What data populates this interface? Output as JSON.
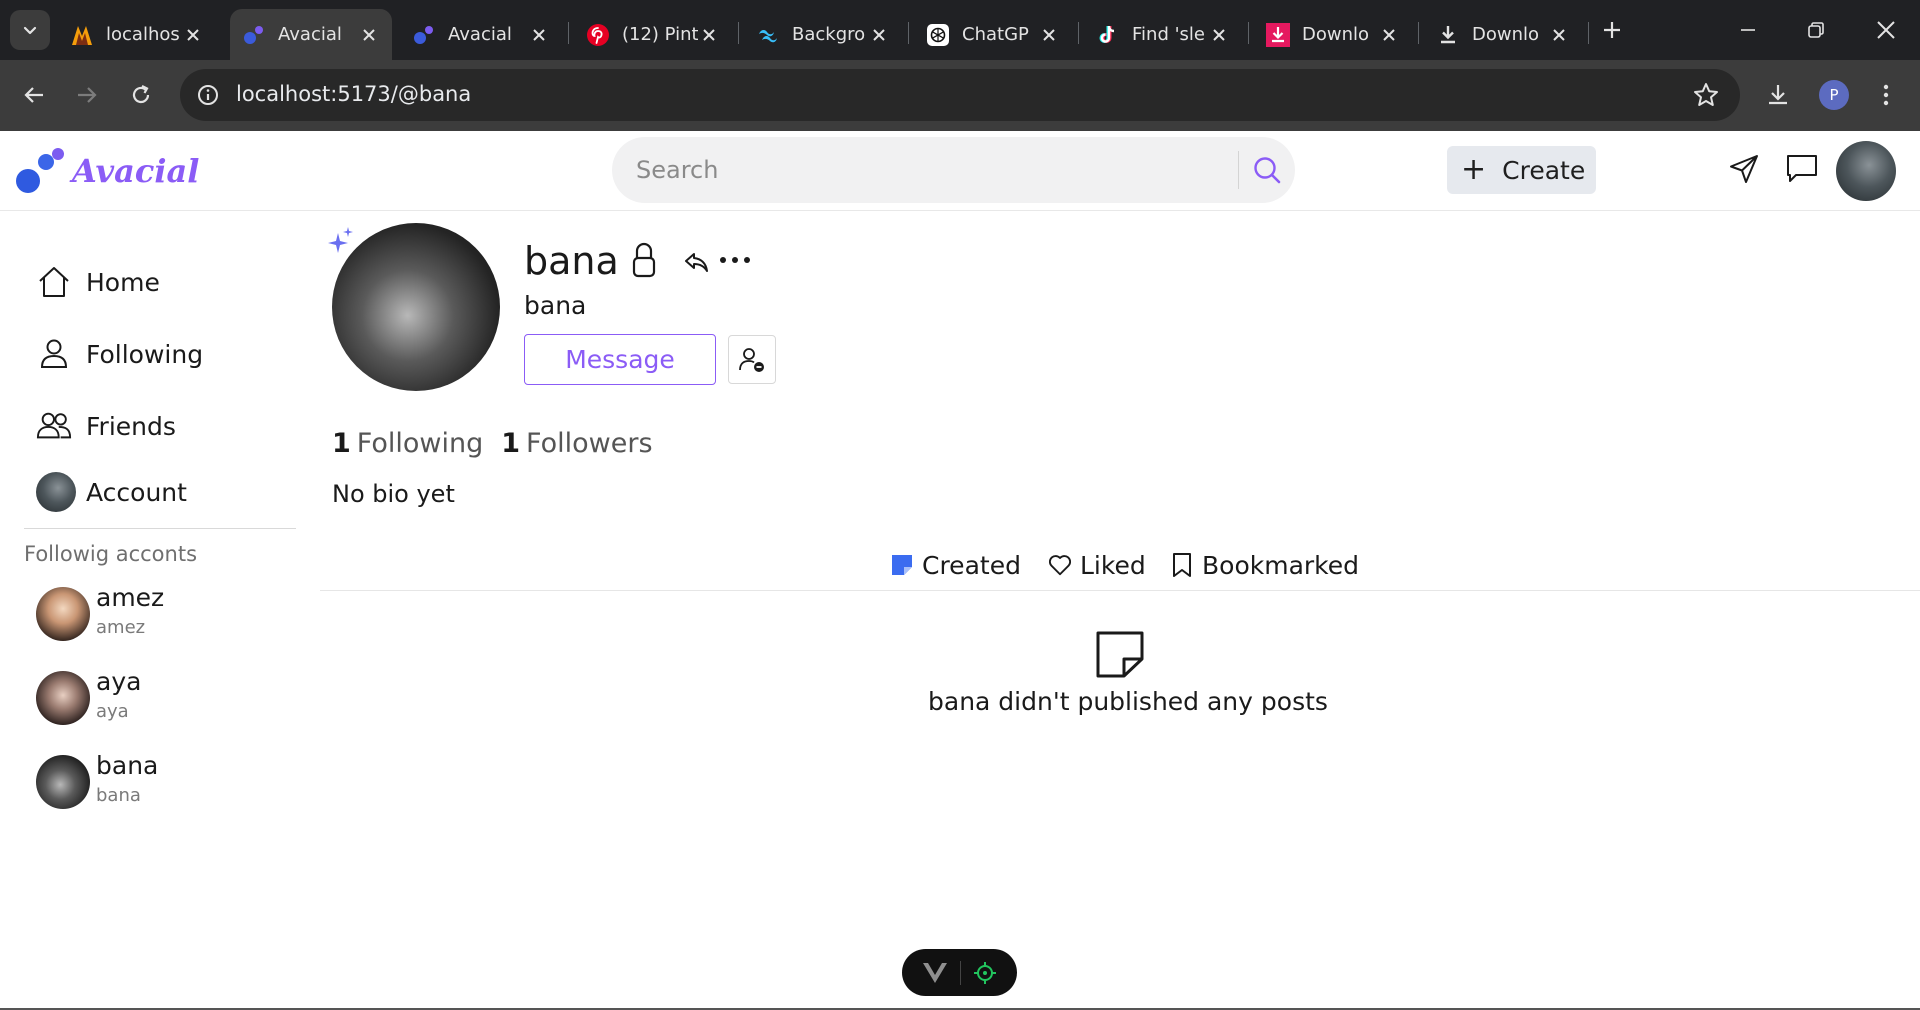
{
  "browser": {
    "tabs": [
      {
        "title": "localhos",
        "icon": "ladder-logo-icon",
        "active": false
      },
      {
        "title": "Avacial",
        "icon": "avacial-logo-icon",
        "active": true
      },
      {
        "title": "Avacial",
        "icon": "avacial-logo-icon",
        "active": false
      },
      {
        "title": "(12) Pint",
        "icon": "pinterest-icon",
        "active": false
      },
      {
        "title": "Backgro",
        "icon": "tailwind-icon",
        "active": false
      },
      {
        "title": "ChatGP",
        "icon": "chatgpt-icon",
        "active": false
      },
      {
        "title": "Find 'sle",
        "icon": "tiktok-icon",
        "active": false
      },
      {
        "title": "Downlo",
        "icon": "download-pink-icon",
        "active": false
      },
      {
        "title": "Downlo",
        "icon": "download-icon",
        "active": false
      }
    ],
    "url": "localhost:5173/@bana",
    "profile_initial": "P",
    "colors": {
      "tabstrip": "#202124",
      "toolbar": "#3c3c3c",
      "omnibox": "#282828"
    }
  },
  "app": {
    "logo_text": "Avacial",
    "search_placeholder": "Search",
    "create_label": "Create",
    "accent": "#8b5cf6"
  },
  "sidebar": {
    "nav": [
      {
        "label": "Home",
        "icon": "home-icon"
      },
      {
        "label": "Following",
        "icon": "user-icon"
      },
      {
        "label": "Friends",
        "icon": "users-icon"
      },
      {
        "label": "Account",
        "icon": "avatar"
      }
    ],
    "heading": "Followig acconts",
    "following": [
      {
        "name": "amez",
        "handle": "amez"
      },
      {
        "name": "aya",
        "handle": "aya"
      },
      {
        "name": "bana",
        "handle": "bana"
      }
    ]
  },
  "profile": {
    "name": "bana",
    "handle": "bana",
    "message_label": "Message",
    "following_count": "1",
    "following_label": "Following",
    "followers_count": "1",
    "followers_label": "Followers",
    "bio": "No bio yet",
    "tabs": [
      {
        "label": "Created",
        "icon": "note-filled-icon"
      },
      {
        "label": "Liked",
        "icon": "heart-icon"
      },
      {
        "label": "Bookmarked",
        "icon": "bookmark-icon"
      }
    ],
    "empty_message": "bana didn't published any posts"
  }
}
